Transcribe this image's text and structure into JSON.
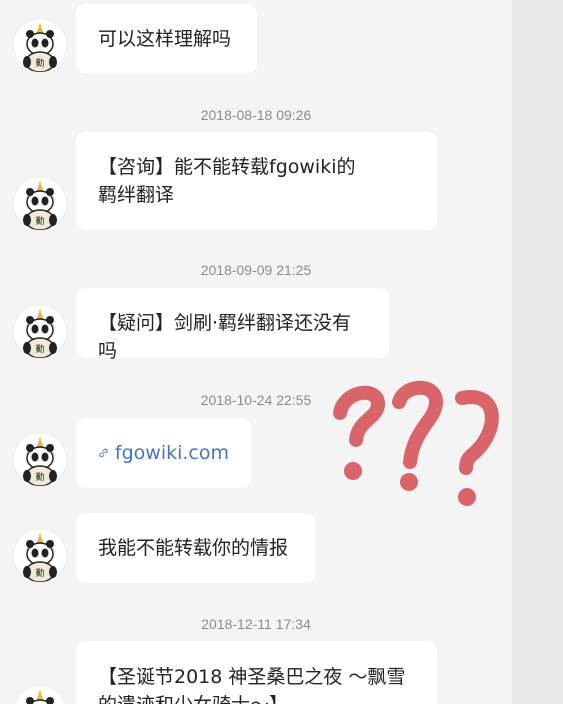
{
  "messages": [
    {
      "text": "可以这样理解吗"
    },
    {
      "timestamp": "2018-08-18 09:26",
      "lines": [
        "【咨询】能不能转载fgowiki的",
        "羁绊翻译"
      ]
    },
    {
      "timestamp": "2018-09-09 21:25",
      "text": "【疑问】剑刷·羁绊翻译还没有吗"
    },
    {
      "timestamp": "2018-10-24 22:55",
      "link": "fgowiki.com",
      "link_icon": "link-icon"
    },
    {
      "text": "我能不能转载你的情报"
    },
    {
      "timestamp": "2018-12-11 17:34",
      "lines": [
        "【圣诞节2018 神圣桑巴之夜 ～飘雪",
        "的遗迹和少女骑士～】"
      ]
    }
  ],
  "avatar": {
    "label": "勤",
    "icon": "panda-avatar-icon"
  },
  "annotation": {
    "marks": "???",
    "color": "#d9646a"
  },
  "colors": {
    "background": "#f4f4f4",
    "bubble": "#ffffff",
    "link": "#4a74b7",
    "timestamp": "#8c8c8c"
  }
}
